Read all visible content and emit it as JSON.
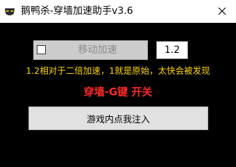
{
  "window": {
    "title": "鹅鸭杀-穿墙加速助手v3.6",
    "icon": "mask-icon",
    "close_icon": "close-icon"
  },
  "speed": {
    "toggle_label": "移动加速",
    "checked": false,
    "multiplier_value": "1.2"
  },
  "hint_text": "1.2相对于二倍加速，1就是原始，太快会被发现",
  "hotkey_text": "穿墙-G键 开关",
  "inject_button_label": "游戏内点我注入",
  "colors": {
    "background": "#000000",
    "hint": "#ffd700",
    "hotkey": "#ff2a2a",
    "disabled_text": "#8a8a8a"
  }
}
